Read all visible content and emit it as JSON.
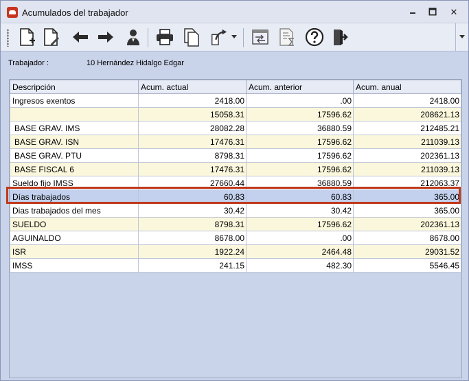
{
  "window": {
    "title": "Acumulados del trabajador",
    "minimize_glyph": "🗕",
    "maximize_glyph": "🗖",
    "close_glyph": "✕"
  },
  "toolbar": {
    "icons": [
      "new-document-icon",
      "edit-document-icon",
      "arrow-left-icon",
      "arrow-right-icon",
      "person-icon",
      "print-icon",
      "copy-icon",
      "export-arrow-icon",
      "window-transfer-icon",
      "document-sum-icon",
      "help-icon",
      "exit-door-icon"
    ],
    "more_glyph": "▾"
  },
  "worker": {
    "label": "Trabajador :",
    "value": "10 Hernández Hidalgo Edgar"
  },
  "grid": {
    "headers": [
      "Descripción",
      "Acum. actual",
      "Acum. anterior",
      "Acum. anual"
    ],
    "rows": [
      [
        "Ingresos exentos",
        "2418.00",
        ".00",
        "2418.00"
      ],
      [
        "",
        "15058.31",
        "17596.62",
        "208621.13"
      ],
      [
        "BASE GRAV. IMS",
        "28082.28",
        "36880.59",
        "212485.21"
      ],
      [
        "BASE GRAV. ISN",
        "17476.31",
        "17596.62",
        "211039.13"
      ],
      [
        "BASE GRAV. PTU",
        "8798.31",
        "17596.62",
        "202361.13"
      ],
      [
        "BASE FISCAL 6",
        "17476.31",
        "17596.62",
        "211039.13"
      ],
      [
        "Sueldo fijo IMSS",
        "27660.44",
        "36880.59",
        "212063.37"
      ],
      [
        "Días trabajados",
        "60.83",
        "60.83",
        "365.00"
      ],
      [
        "Dias trabajados del mes",
        "30.42",
        "30.42",
        "365.00"
      ],
      [
        "SUELDO",
        "8798.31",
        "17596.62",
        "202361.13"
      ],
      [
        "AGUINALDO",
        "8678.00",
        ".00",
        "8678.00"
      ],
      [
        "ISR",
        "1922.24",
        "2464.48",
        "29031.52"
      ],
      [
        "IMSS",
        "241.15",
        "482.30",
        "5546.45"
      ]
    ]
  },
  "colors": {
    "highlight": "#c0391b",
    "selected_row": "#c3d1ee",
    "alt_row": "#fbf7dd"
  }
}
